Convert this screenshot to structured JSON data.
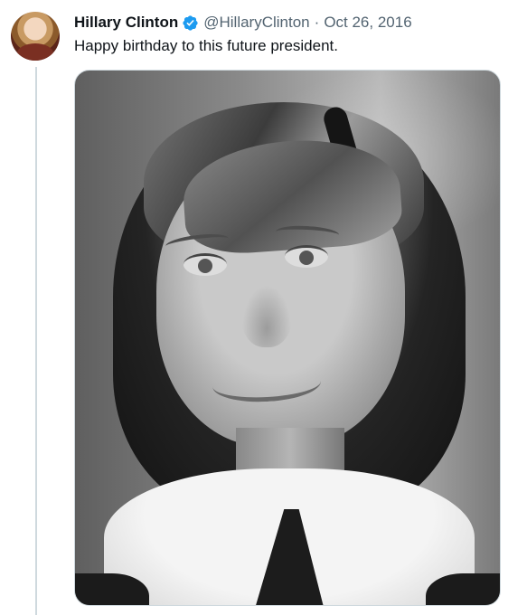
{
  "tweet": {
    "author_name": "Hillary Clinton",
    "handle": "@HillaryClinton",
    "separator": "·",
    "date": "Oct 26, 2016",
    "text": "Happy birthday to this future president.",
    "verified_icon": "verified-badge-icon"
  },
  "colors": {
    "primary_text": "#0f1419",
    "secondary_text": "#536471",
    "verified_blue": "#1d9bf0",
    "thread_line": "#cfd9de",
    "media_border": "#cfd9de"
  },
  "media": {
    "kind": "black-and-white portrait photo"
  }
}
